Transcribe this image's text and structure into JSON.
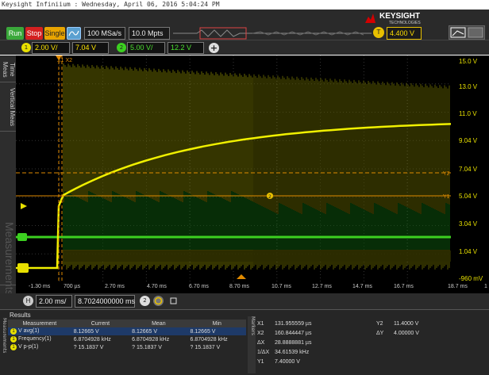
{
  "window": {
    "title": "Keysight Infiniium : Wednesday, April 06, 2016 5:04:24 PM"
  },
  "brand": {
    "name": "KEYSIGHT",
    "sub": "TECHNOLOGIES",
    "logo_color": "#d40000"
  },
  "toolbar": {
    "run_label": "Run",
    "stop_label": "Stop",
    "single_label": "Single",
    "sample_rate": "100 MSa/s",
    "memory_depth": "10.0 Mpts",
    "trigger_badge": "T",
    "trigger_level": "4.400 V"
  },
  "channels": {
    "ch1": {
      "badge": "1",
      "scale": "2.00 V/",
      "offset": "7.04 V",
      "color": "#e8e000"
    },
    "ch2": {
      "badge": "2",
      "scale": "5.00 V/",
      "offset": "12.2 V",
      "color": "#3cd020"
    },
    "add_label": "+"
  },
  "side_tabs": {
    "time": "Time",
    "meas": "Meas",
    "vertical": "Vertical Meas",
    "measurements": "Measurements"
  },
  "y_axis": [
    "15.0 V",
    "13.0 V",
    "11.0 V",
    "9.04 V",
    "7.04 V",
    "5.04 V",
    "3.04 V",
    "1.04 V",
    "-960 mV"
  ],
  "x_axis": [
    "-1.30 ms",
    "700 µs",
    "2.70 ms",
    "4.70 ms",
    "6.70 ms",
    "8.70 ms",
    "10.7 ms",
    "12.7 ms",
    "14.7 ms",
    "16.7 ms",
    "18.7 ms"
  ],
  "x_axis_end": "1",
  "markers_on_screen": {
    "x1": "X1",
    "x2": "X2",
    "y1": "Y1",
    "y2": "Y2",
    "center": "2"
  },
  "timebase": {
    "badge": "H",
    "scale": "2.00 ms/",
    "position": "8.7024000000 ms",
    "ch_badge": "2"
  },
  "results": {
    "title": "Results",
    "side_label": "Measurements",
    "headers": [
      "Measurement",
      "Current",
      "Mean",
      "Min"
    ],
    "rows": [
      {
        "badge": "1",
        "name": "V avg(1)",
        "current": "8.12665 V",
        "mean": "8.12665 V",
        "min": "8.12665 V"
      },
      {
        "badge": "1",
        "name": "Frequency(1)",
        "current": "6.8704928 kHz",
        "mean": "6.8704928 kHz",
        "min": "6.8704928 kHz"
      },
      {
        "badge": "1",
        "name": "V p-p(1)",
        "current": "? 15.1837 V",
        "mean": "? 15.1837 V",
        "min": "? 15.1837 V"
      }
    ]
  },
  "markers_panel": {
    "side_label": "Markers",
    "x1_label": "X1",
    "x1": "131.955559 µs",
    "x2_label": "X2",
    "x2": "160.844447 µs",
    "dx_label": "ΔX",
    "dx": "28.8888881 µs",
    "inv_dx_label": "1/ΔX",
    "inv_dx": "34.61539 kHz",
    "y1_label": "Y1",
    "y1": "7.40000 V",
    "y2_label": "Y2",
    "y2": "11.4000 V",
    "dy_label": "ΔY",
    "dy": "4.00000 V"
  }
}
